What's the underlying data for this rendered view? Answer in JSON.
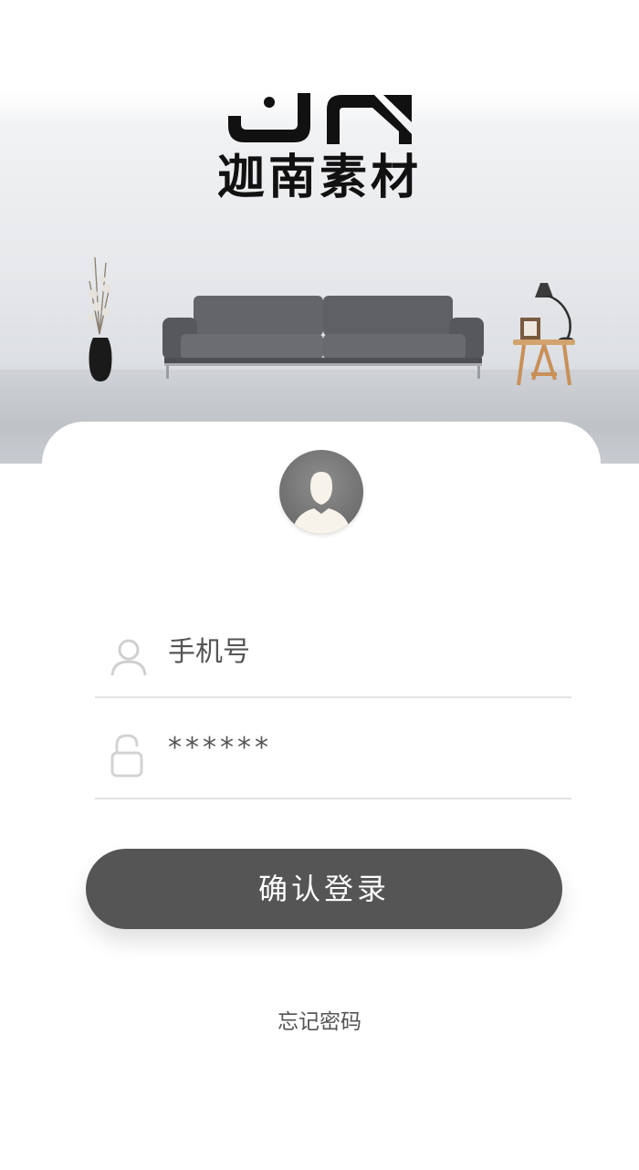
{
  "brand": {
    "name": "迦南素材",
    "logo_mark": "JN"
  },
  "form": {
    "phone_placeholder": "手机号",
    "password_value": "******"
  },
  "actions": {
    "login_label": "确认登录",
    "forgot_label": "忘记密码"
  },
  "icons": {
    "avatar": "user-avatar-icon",
    "phone": "user-outline-icon",
    "password": "unlock-icon"
  },
  "colors": {
    "button": "#555555",
    "text": "#555555",
    "divider": "#e3e3e3"
  }
}
